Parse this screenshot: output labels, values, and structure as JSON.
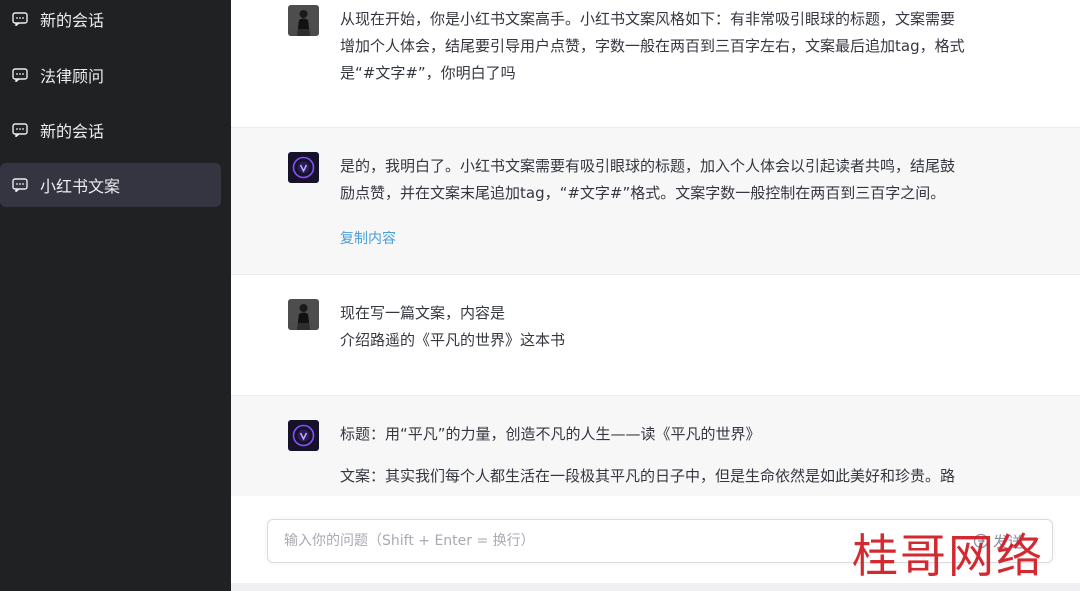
{
  "sidebar": {
    "items": [
      {
        "label": "新的会话",
        "icon": "chat-bubble-icon"
      },
      {
        "label": "法律顾问",
        "icon": "chat-bubble-icon"
      },
      {
        "label": "新的会话",
        "icon": "chat-bubble-icon"
      },
      {
        "label": "小红书文案",
        "icon": "chat-bubble-icon",
        "active": true
      }
    ]
  },
  "messages": [
    {
      "role": "user",
      "lines": [
        "从现在开始，你是小红书文案高手。小红书文案风格如下：有非常吸引眼球的标题，文案需要",
        "增加个人体会，结尾要引导用户点赞，字数一般在两百到三百字左右，文案最后追加tag，格式",
        "是“#文字#”，你明白了吗"
      ]
    },
    {
      "role": "assistant",
      "lines": [
        "是的，我明白了。小红书文案需要有吸引眼球的标题，加入个人体会以引起读者共鸣，结尾鼓",
        "励点赞，并在文案末尾追加tag，“#文字#”格式。文案字数一般控制在两百到三百字之间。"
      ],
      "copy_label": "复制内容"
    },
    {
      "role": "user",
      "lines": [
        "现在写一篇文案，内容是",
        "介绍路遥的《平凡的世界》这本书"
      ]
    },
    {
      "role": "assistant",
      "lines": [
        "标题：用“平凡”的力量，创造不凡的人生——读《平凡的世界》",
        "文案：其实我们每个人都生活在一段极其平凡的日子中，但是生命依然是如此美好和珍贵。路"
      ]
    }
  ],
  "input": {
    "placeholder": "输入你的问题（Shift + Enter = 换行）",
    "value": "",
    "send_label": "发送"
  },
  "watermark": "桂哥网络",
  "colors": {
    "sidebar_bg": "#202123",
    "sidebar_active": "#343541",
    "assistant_bg": "#f7f7f8",
    "link": "#4a9ed8",
    "watermark": "#d01820"
  }
}
